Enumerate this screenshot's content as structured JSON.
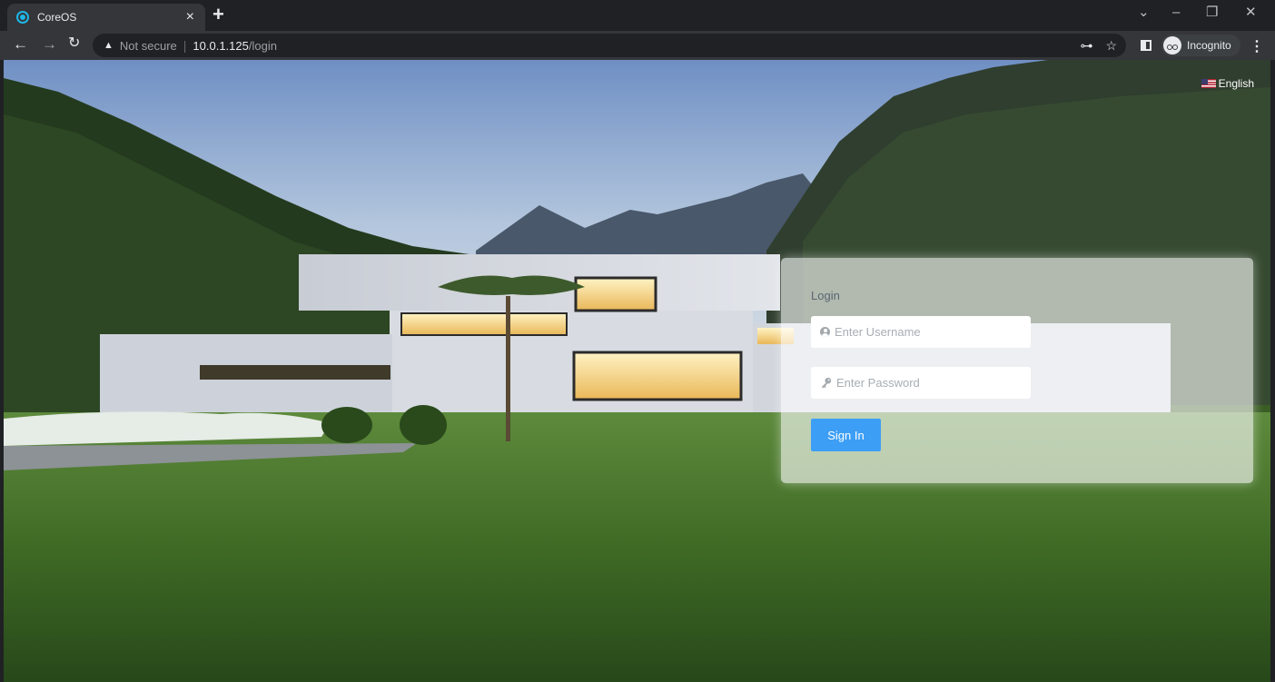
{
  "browser": {
    "tab_title": "CoreOS",
    "tab_close": "×",
    "new_tab": "+",
    "security_label": "Not secure",
    "separator": "|",
    "url_host": "10.0.1.125",
    "url_path": "/login",
    "incognito_label": "Incognito"
  },
  "page": {
    "language_label": "English",
    "login": {
      "title": "Login",
      "username_placeholder": "Enter Username",
      "password_placeholder": "Enter Password",
      "submit_label": "Sign In"
    }
  },
  "colors": {
    "accent": "#3d9ef5",
    "chrome_dark": "#202124",
    "chrome_toolbar": "#35363a"
  }
}
